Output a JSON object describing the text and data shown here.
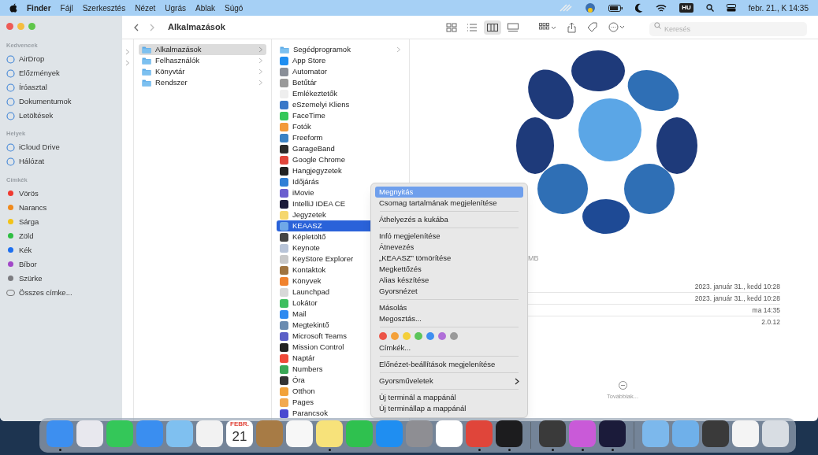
{
  "menu_bar": {
    "app_name": "Finder",
    "menus": [
      "Fájl",
      "Szerkesztés",
      "Nézet",
      "Ugrás",
      "Ablak",
      "Súgó"
    ],
    "input_source": "HU",
    "clock": "febr. 21., K 14:35"
  },
  "window": {
    "title": "Alkalmazások",
    "views": [
      {
        "selected": false
      },
      {
        "selected": false
      },
      {
        "selected": true
      },
      {
        "selected": false
      }
    ],
    "search": {
      "placeholder": "Keresés"
    }
  },
  "sidebar": [
    {
      "heading": "Kedvencek",
      "items": [
        {
          "label": "AirDrop",
          "kind": "place"
        },
        {
          "label": "Előzmények",
          "kind": "place"
        },
        {
          "label": "Íróasztal",
          "kind": "place"
        },
        {
          "label": "Dokumentumok",
          "kind": "place"
        },
        {
          "label": "Letöltések",
          "kind": "place"
        }
      ]
    },
    {
      "heading": "Helyek",
      "items": [
        {
          "label": "iCloud Drive",
          "kind": "place"
        },
        {
          "label": "Hálózat",
          "kind": "place"
        }
      ]
    },
    {
      "heading": "Címkék",
      "items": [
        {
          "label": "Vörös",
          "kind": "tag",
          "color": "#f03a30"
        },
        {
          "label": "Narancs",
          "kind": "tag",
          "color": "#f08a1c"
        },
        {
          "label": "Sárga",
          "kind": "tag",
          "color": "#f2c318"
        },
        {
          "label": "Zöld",
          "kind": "tag",
          "color": "#2fbe43"
        },
        {
          "label": "Kék",
          "kind": "tag",
          "color": "#1d6ff0"
        },
        {
          "label": "Bíbor",
          "kind": "tag",
          "color": "#a248c8"
        },
        {
          "label": "Szürke",
          "kind": "tag",
          "color": "#7c7c80"
        },
        {
          "label": "Összes címke...",
          "kind": "all-tags"
        }
      ]
    }
  ],
  "column_1": [
    {
      "kind": "folder"
    },
    {
      "kind": "folder"
    }
  ],
  "column_2": [
    {
      "label": "Alkalmazások",
      "kind": "folder",
      "selected": true
    },
    {
      "label": "Felhasználók",
      "kind": "folder",
      "selected": false
    },
    {
      "label": "Könyvtár",
      "kind": "folder",
      "selected": false
    },
    {
      "label": "Rendszer",
      "kind": "folder",
      "selected": false
    }
  ],
  "column_3": [
    {
      "label": "Segédprogramok",
      "kind": "folder",
      "selected": false
    },
    {
      "label": "App Store",
      "kind": "app",
      "color": "#1f8ef1",
      "selected": false
    },
    {
      "label": "Automator",
      "kind": "app",
      "color": "#8a8f98",
      "selected": false
    },
    {
      "label": "Betűtár",
      "kind": "app",
      "color": "#9a9a9a",
      "selected": false
    },
    {
      "label": "Emlékeztetők",
      "kind": "app",
      "color": "#eeeeee",
      "selected": false
    },
    {
      "label": "eSzemelyi Kliens",
      "kind": "app",
      "color": "#3a78c8",
      "selected": false
    },
    {
      "label": "FaceTime",
      "kind": "app",
      "color": "#34c759",
      "selected": false
    },
    {
      "label": "Fotók",
      "kind": "app",
      "color": "#f29a3a",
      "selected": false
    },
    {
      "label": "Freeform",
      "kind": "app",
      "color": "#3b82c4",
      "selected": false
    },
    {
      "label": "GarageBand",
      "kind": "app",
      "color": "#2b2b2b",
      "selected": false
    },
    {
      "label": "Google Chrome",
      "kind": "app",
      "color": "#e0453a",
      "selected": false
    },
    {
      "label": "Hangjegyzetek",
      "kind": "app",
      "color": "#222222",
      "selected": false
    },
    {
      "label": "Időjárás",
      "kind": "app",
      "color": "#2f7fd6",
      "selected": false
    },
    {
      "label": "iMovie",
      "kind": "app",
      "color": "#6b5fcf",
      "selected": false
    },
    {
      "label": "IntelliJ IDEA CE",
      "kind": "app",
      "color": "#1b1b3a",
      "selected": false
    },
    {
      "label": "Jegyzetek",
      "kind": "app",
      "color": "#f5d76e",
      "selected": false
    },
    {
      "label": "KEAASZ",
      "kind": "app",
      "color": "#6fa8e8",
      "selected": true
    },
    {
      "label": "Képletöltő",
      "kind": "app",
      "color": "#444444",
      "selected": false
    },
    {
      "label": "Keynote",
      "kind": "app",
      "color": "#b8c4d8",
      "selected": false
    },
    {
      "label": "KeyStore Explorer",
      "kind": "app",
      "color": "#c8c8c8",
      "selected": false
    },
    {
      "label": "Kontaktok",
      "kind": "app",
      "color": "#a0743f",
      "selected": false
    },
    {
      "label": "Könyvek",
      "kind": "app",
      "color": "#f0822e",
      "selected": false
    },
    {
      "label": "Launchpad",
      "kind": "app",
      "color": "#d8d8d8",
      "selected": false
    },
    {
      "label": "Lokátor",
      "kind": "app",
      "color": "#3fbf5f",
      "selected": false
    },
    {
      "label": "Mail",
      "kind": "app",
      "color": "#2f8af0",
      "selected": false
    },
    {
      "label": "Megtekintő",
      "kind": "app",
      "color": "#6a8bb0",
      "selected": false
    },
    {
      "label": "Microsoft Teams",
      "kind": "app",
      "color": "#5b5fc7",
      "selected": false
    },
    {
      "label": "Mission Control",
      "kind": "app",
      "color": "#222222",
      "selected": false
    },
    {
      "label": "Naptár",
      "kind": "app",
      "color": "#f04a3a",
      "selected": false
    },
    {
      "label": "Numbers",
      "kind": "app",
      "color": "#3aa856",
      "selected": false
    },
    {
      "label": "Óra",
      "kind": "app",
      "color": "#333333",
      "selected": false
    },
    {
      "label": "Otthon",
      "kind": "app",
      "color": "#f2a23a",
      "selected": false
    },
    {
      "label": "Pages",
      "kind": "app",
      "color": "#f2a950",
      "selected": false
    },
    {
      "label": "Parancsok",
      "kind": "app",
      "color": "#4a4ad0",
      "selected": false
    }
  ],
  "preview": {
    "size_fragment": "MB",
    "info_rows": [
      {
        "value": "2023. január 31., kedd 10:28"
      },
      {
        "value": "2023. január 31., kedd 10:28"
      },
      {
        "value": "ma 14:35"
      },
      {
        "value": "2.0.12"
      }
    ],
    "more_label": "Továbbiak..."
  },
  "context_menu": {
    "groups": [
      [
        {
          "label": "Megnyitás",
          "selected": true,
          "submenu": false
        },
        {
          "label": "Csomag tartalmának megjelenítése",
          "selected": false,
          "submenu": false
        }
      ],
      [
        {
          "label": "Áthelyezés a kukába",
          "selected": false,
          "submenu": false
        }
      ],
      [
        {
          "label": "Infó megjelenítése",
          "selected": false,
          "submenu": false
        },
        {
          "label": "Átnevezés",
          "selected": false,
          "submenu": false
        },
        {
          "label": "„KEAASZ” tömörítése",
          "selected": false,
          "submenu": false
        },
        {
          "label": "Megkettőzés",
          "selected": false,
          "submenu": false
        },
        {
          "label": "Alias készítése",
          "selected": false,
          "submenu": false
        },
        {
          "label": "Gyorsnézet",
          "selected": false,
          "submenu": false
        }
      ],
      [
        {
          "label": "Másolás",
          "selected": false,
          "submenu": false
        },
        {
          "label": "Megosztás...",
          "selected": false,
          "submenu": false
        }
      ],
      [
        {
          "kind": "tags",
          "dots": [
            {
              "color": "#ec5548"
            },
            {
              "color": "#f4a13a"
            },
            {
              "color": "#f4cf3a"
            },
            {
              "color": "#5cc55a"
            },
            {
              "color": "#3f8ff0"
            },
            {
              "color": "#b06fd8"
            },
            {
              "color": "#9a9a9a"
            }
          ]
        },
        {
          "label": "Címkék...",
          "selected": false,
          "submenu": false
        }
      ],
      [
        {
          "label": "Előnézet-beállítások megjelenítése",
          "selected": false,
          "submenu": false
        }
      ],
      [
        {
          "label": "Gyorsműveletek",
          "selected": false,
          "submenu": true
        }
      ],
      [
        {
          "label": "Új terminál a mappánál",
          "selected": false,
          "submenu": false
        },
        {
          "label": "Új terminállap a mappánál",
          "selected": false,
          "submenu": false
        }
      ]
    ]
  },
  "dock": [
    {
      "kind": "app",
      "color": "#3d8ff0",
      "running": true
    },
    {
      "kind": "app",
      "color": "#e8e8ee",
      "running": false
    },
    {
      "kind": "app",
      "color": "#34c759",
      "running": false
    },
    {
      "kind": "app",
      "color": "#3a8ef0",
      "running": false
    },
    {
      "kind": "app",
      "color": "#7fc0f0",
      "running": false
    },
    {
      "kind": "app",
      "color": "#f2f2f2",
      "running": false
    },
    {
      "kind": "calendar",
      "month": "FEBR.",
      "day": "21",
      "running": false
    },
    {
      "kind": "app",
      "color": "#a77b45",
      "running": false
    },
    {
      "kind": "app",
      "color": "#f7f7f7",
      "running": false
    },
    {
      "kind": "app",
      "color": "#f7e27a",
      "running": true
    },
    {
      "kind": "app",
      "color": "#2fc14f",
      "running": false
    },
    {
      "kind": "app",
      "color": "#1f8ef1",
      "running": false
    },
    {
      "kind": "app",
      "color": "#8e8e93",
      "running": false
    },
    {
      "kind": "app",
      "color": "#ffffff",
      "running": false
    },
    {
      "kind": "app",
      "color": "#e0453a",
      "running": true
    },
    {
      "kind": "app",
      "color": "#1c1c1e",
      "running": true
    },
    {
      "kind": "separator"
    },
    {
      "kind": "app",
      "color": "#3a3a3a",
      "running": true
    },
    {
      "kind": "app",
      "color": "#c95ad8",
      "running": true
    },
    {
      "kind": "app",
      "color": "#1b1b3a",
      "running": true
    },
    {
      "kind": "separator"
    },
    {
      "kind": "app",
      "color": "#7cb8ec",
      "running": false
    },
    {
      "kind": "app",
      "color": "#6fb0ea",
      "running": false
    },
    {
      "kind": "app",
      "color": "#3a3a3a",
      "running": false
    },
    {
      "kind": "app",
      "color": "#f4f4f4",
      "running": false
    },
    {
      "kind": "app",
      "color": "#d8dde3",
      "running": false
    }
  ]
}
